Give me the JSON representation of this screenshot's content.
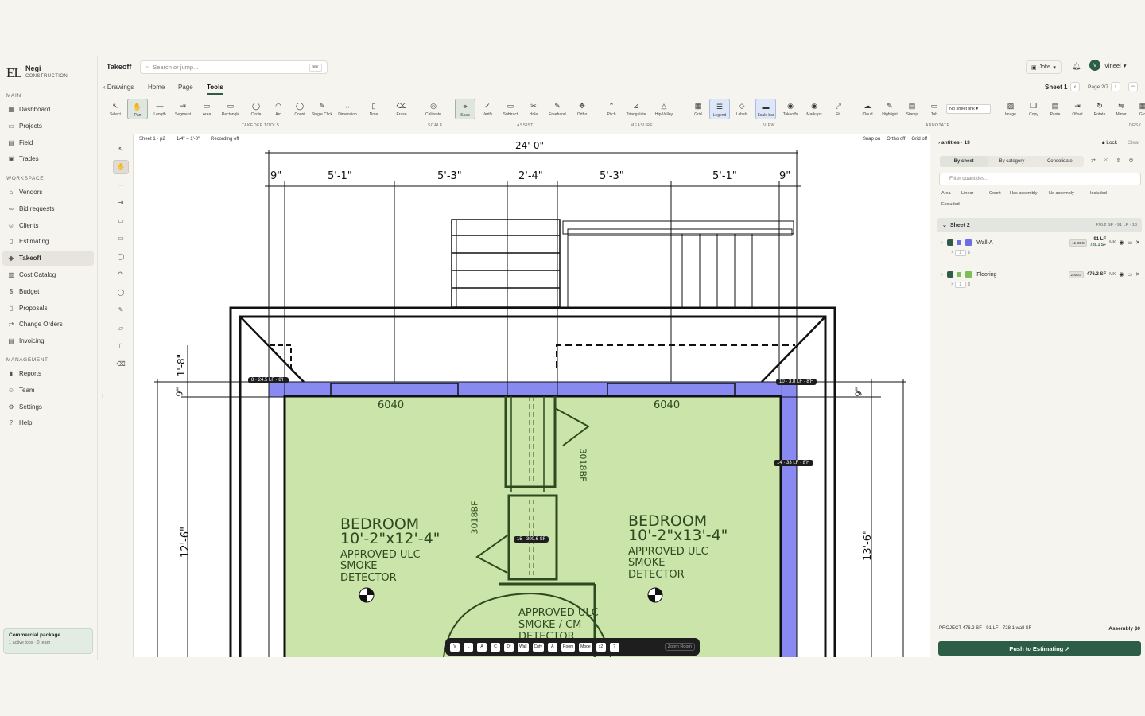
{
  "brand": {
    "logo": "EL",
    "name": "Negi",
    "sub": "CONSTRUCTION"
  },
  "sidebar": {
    "sections": [
      "MAIN",
      "WORKSPACE",
      "MANAGEMENT"
    ],
    "main": [
      {
        "label": "Dashboard",
        "icon": "grid-icon"
      },
      {
        "label": "Projects",
        "icon": "folder-icon"
      },
      {
        "label": "Field",
        "icon": "clipboard-icon"
      },
      {
        "label": "Trades",
        "icon": "briefcase-icon"
      }
    ],
    "workspace": [
      {
        "label": "Vendors",
        "icon": "building-icon"
      },
      {
        "label": "Bid requests",
        "icon": "link-icon"
      },
      {
        "label": "Clients",
        "icon": "people-icon"
      },
      {
        "label": "Estimating",
        "icon": "document-icon"
      },
      {
        "label": "Takeoff",
        "icon": "layers-icon",
        "active": true
      },
      {
        "label": "Cost Catalog",
        "icon": "book-icon"
      },
      {
        "label": "Budget",
        "icon": "dollar-icon"
      },
      {
        "label": "Proposals",
        "icon": "file-icon"
      },
      {
        "label": "Change Orders",
        "icon": "swap-icon"
      },
      {
        "label": "Invoicing",
        "icon": "receipt-icon"
      }
    ],
    "management": [
      {
        "label": "Reports",
        "icon": "chart-icon"
      },
      {
        "label": "Team",
        "icon": "team-icon"
      },
      {
        "label": "Settings",
        "icon": "gear-icon"
      },
      {
        "label": "Help",
        "icon": "help-icon"
      }
    ],
    "package": {
      "title": "Commercial package",
      "sub": "1 active jobs · 0 team"
    }
  },
  "header": {
    "title": "Takeoff",
    "search_placeholder": "Search or jump...",
    "search_kbd": "⌘K",
    "jobs": "Jobs",
    "user": "Vineel",
    "user_initial": "V"
  },
  "tabs": {
    "back": "Drawings",
    "items": [
      "Home",
      "Page",
      "Tools"
    ],
    "active": "Tools",
    "sheet": "Sheet 1",
    "page": "Page 2/7"
  },
  "ribbon": {
    "tools": [
      "Select",
      "Pan",
      "Length",
      "Segment",
      "Area",
      "Rectangle",
      "Circle",
      "Arc",
      "Count",
      "Single Click",
      "Dimension",
      "Note",
      "Erase",
      "Calibrate",
      "Snap",
      "Verify",
      "Subtract",
      "Hole",
      "Freehand",
      "Ortho",
      "Pitch",
      "Triangulate",
      "Hip/Valley",
      "Grid",
      "Legend",
      "Labels",
      "Scale bar",
      "Takeoffs",
      "Markups",
      "Fit",
      "Cloud",
      "Highlight",
      "Stamp",
      "Tab",
      "Image",
      "Copy",
      "Paste",
      "Offset",
      "Rotate",
      "Mirror",
      "Gro"
    ],
    "groups": [
      "TAKEOFF TOOLS",
      "SCALE",
      "ASSIST",
      "MEASURE",
      "VIEW",
      "ANNOTATE",
      "DESK"
    ],
    "sheet_link": "No sheet link"
  },
  "canvas": {
    "info": [
      "Sheet 1 · p2",
      "1/4\" = 1'-0\"",
      "Recording off"
    ],
    "toggles": [
      "Snap on",
      "Ortho off",
      "Grid off"
    ],
    "dims_top": [
      "24'-0\"",
      "9\"",
      "5'-1\"",
      "5'-3\"",
      "2'-4\"",
      "5'-3\"",
      "5'-1\"",
      "9\""
    ],
    "dims_side": [
      "1'-8\"",
      "9\"",
      "12'-6\"",
      "9\"",
      "13'-6\""
    ],
    "rooms": [
      {
        "name": "BEDROOM",
        "size": "10'-2\"x12'-4\"",
        "note1": "APPROVED ULC",
        "note2": "SMOKE",
        "note3": "DETECTOR"
      },
      {
        "name": "BEDROOM",
        "size": "10'-2\"x13'-4\"",
        "note1": "APPROVED ULC",
        "note2": "SMOKE",
        "note3": "DETECTOR"
      }
    ],
    "windows": [
      "6040",
      "6040"
    ],
    "doors": [
      "3018BF",
      "3018BF"
    ],
    "bottom_note": [
      "APPROVED ULC",
      "SMOKE / CM",
      "DETECTOR"
    ],
    "pills": [
      "8 · 24.5 LF · 8'H",
      "10 · 3.8 LF · 8'H",
      "14 · 33 LF · 8'H",
      "15 · 300.6 SF"
    ],
    "dock": [
      "V",
      "L",
      "A",
      "C",
      "Dr",
      "Wall",
      "Cnty",
      "A",
      "Room",
      "Mode",
      "x2",
      "?"
    ],
    "dock_more": "Zoom Room",
    "colors": {
      "wall": "#7b7cf0",
      "floor": "#c8e3a4"
    }
  },
  "panel": {
    "title": "antities · 13",
    "lock": "Lock",
    "clear": "Clear",
    "tabs": [
      "By sheet",
      "By category",
      "Consolidate"
    ],
    "filter_placeholder": "Filter quantities...",
    "chips": [
      "Area",
      "Linear",
      "Count",
      "Has assembly",
      "No assembly",
      "Included",
      "Excluded"
    ],
    "sheet": {
      "name": "Sheet 2",
      "summary": "476.2 SF · 91 LF · 13"
    },
    "rows": [
      {
        "name": "Wall-A",
        "badge": "11 SEG",
        "val1": "91 LF",
        "val2": "728.1 SF",
        "mk": "MK",
        "color": "#6b6fe0",
        "qty": "1"
      },
      {
        "name": "Flooring",
        "badge": "2 SEG",
        "val1": "476.2 SF",
        "val2": "",
        "mk": "MK",
        "color": "#7cbf58",
        "qty": "1"
      }
    ],
    "project": "PROJECT  476.2 SF · 91 LF · 728.1 wall SF",
    "assembly": "Assembly $0",
    "push": "Push to Estimating ↗"
  }
}
